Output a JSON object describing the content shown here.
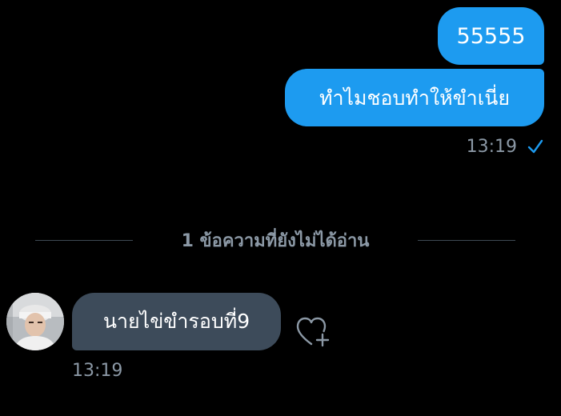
{
  "conversation": {
    "outgoing": [
      {
        "text": "55555"
      },
      {
        "text": "ทำไมชอบทำให้ขำเนี่ย"
      }
    ],
    "outgoing_time": "13:19",
    "outgoing_status_icon": "sent-check-icon",
    "unread_divider": "1 ข้อความที่ยังไม่ได้อ่าน",
    "incoming": {
      "text": "นายไข่ขำรอบที่9",
      "time": "13:19",
      "reaction_icon": "heart-plus-icon"
    }
  },
  "colors": {
    "background": "#000000",
    "outgoing_bubble": "#1d9bf0",
    "incoming_bubble": "#3d4b5a",
    "meta_text": "#8b98a5",
    "check": "#1d9bf0"
  }
}
